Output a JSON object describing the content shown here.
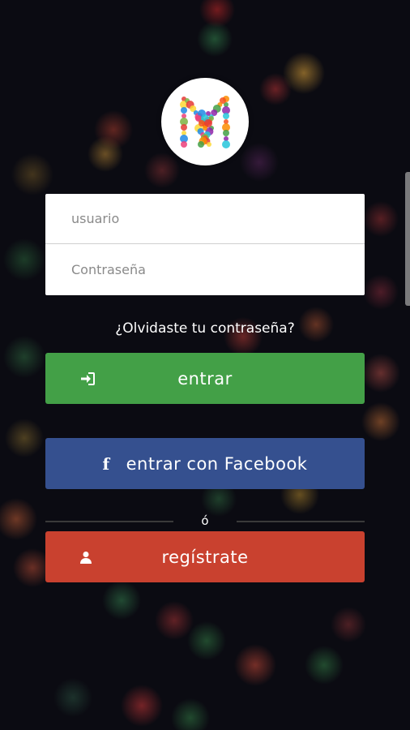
{
  "login": {
    "username_placeholder": "usuario",
    "password_placeholder": "Contraseña",
    "forgot_password": "¿Olvidaste tu contraseña?"
  },
  "buttons": {
    "enter_label": "entrar",
    "facebook_label": "entrar con Facebook",
    "register_label": "regístrate"
  },
  "divider_text": "ó",
  "icons": {
    "enter": "sign-in-icon",
    "facebook": "facebook-icon",
    "register": "user-icon",
    "logo": "heart-m-logo"
  },
  "colors": {
    "enter_button": "#43a047",
    "facebook_button": "#35508f",
    "register_button": "#c9412f"
  }
}
